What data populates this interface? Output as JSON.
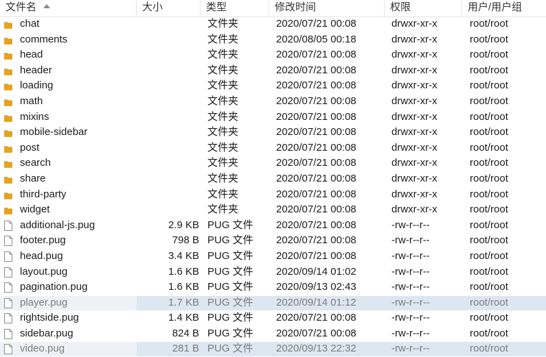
{
  "columns": {
    "name": "文件名",
    "size": "大小",
    "type": "类型",
    "modified": "修改时间",
    "perm": "权限",
    "owner": "用户/用户组"
  },
  "colors": {
    "folder": "#e8a317",
    "selection": "#dde7f1",
    "file_outline": "#8a8a8a"
  },
  "files": [
    {
      "name": "chat",
      "size": "",
      "type": "文件夹",
      "modified": "2020/07/21 00:08",
      "perm": "drwxr-xr-x",
      "owner": "root/root",
      "icon": "folder-icon",
      "selected": false
    },
    {
      "name": "comments",
      "size": "",
      "type": "文件夹",
      "modified": "2020/08/05 00:18",
      "perm": "drwxr-xr-x",
      "owner": "root/root",
      "icon": "folder-icon",
      "selected": false
    },
    {
      "name": "head",
      "size": "",
      "type": "文件夹",
      "modified": "2020/07/21 00:08",
      "perm": "drwxr-xr-x",
      "owner": "root/root",
      "icon": "folder-icon",
      "selected": false
    },
    {
      "name": "header",
      "size": "",
      "type": "文件夹",
      "modified": "2020/07/21 00:08",
      "perm": "drwxr-xr-x",
      "owner": "root/root",
      "icon": "folder-icon",
      "selected": false
    },
    {
      "name": "loading",
      "size": "",
      "type": "文件夹",
      "modified": "2020/07/21 00:08",
      "perm": "drwxr-xr-x",
      "owner": "root/root",
      "icon": "folder-icon",
      "selected": false
    },
    {
      "name": "math",
      "size": "",
      "type": "文件夹",
      "modified": "2020/07/21 00:08",
      "perm": "drwxr-xr-x",
      "owner": "root/root",
      "icon": "folder-icon",
      "selected": false
    },
    {
      "name": "mixins",
      "size": "",
      "type": "文件夹",
      "modified": "2020/07/21 00:08",
      "perm": "drwxr-xr-x",
      "owner": "root/root",
      "icon": "folder-icon",
      "selected": false
    },
    {
      "name": "mobile-sidebar",
      "size": "",
      "type": "文件夹",
      "modified": "2020/07/21 00:08",
      "perm": "drwxr-xr-x",
      "owner": "root/root",
      "icon": "folder-icon",
      "selected": false
    },
    {
      "name": "post",
      "size": "",
      "type": "文件夹",
      "modified": "2020/07/21 00:08",
      "perm": "drwxr-xr-x",
      "owner": "root/root",
      "icon": "folder-icon",
      "selected": false
    },
    {
      "name": "search",
      "size": "",
      "type": "文件夹",
      "modified": "2020/07/21 00:08",
      "perm": "drwxr-xr-x",
      "owner": "root/root",
      "icon": "folder-icon",
      "selected": false
    },
    {
      "name": "share",
      "size": "",
      "type": "文件夹",
      "modified": "2020/07/21 00:08",
      "perm": "drwxr-xr-x",
      "owner": "root/root",
      "icon": "folder-icon",
      "selected": false
    },
    {
      "name": "third-party",
      "size": "",
      "type": "文件夹",
      "modified": "2020/07/21 00:08",
      "perm": "drwxr-xr-x",
      "owner": "root/root",
      "icon": "folder-icon",
      "selected": false
    },
    {
      "name": "widget",
      "size": "",
      "type": "文件夹",
      "modified": "2020/07/21 00:08",
      "perm": "drwxr-xr-x",
      "owner": "root/root",
      "icon": "folder-icon",
      "selected": false
    },
    {
      "name": "additional-js.pug",
      "size": "2.9 KB",
      "type": "PUG 文件",
      "modified": "2020/07/21 00:08",
      "perm": "-rw-r--r--",
      "owner": "root/root",
      "icon": "file-icon",
      "selected": false
    },
    {
      "name": "footer.pug",
      "size": "798 B",
      "type": "PUG 文件",
      "modified": "2020/07/21 00:08",
      "perm": "-rw-r--r--",
      "owner": "root/root",
      "icon": "file-icon",
      "selected": false
    },
    {
      "name": "head.pug",
      "size": "3.4 KB",
      "type": "PUG 文件",
      "modified": "2020/07/21 00:08",
      "perm": "-rw-r--r--",
      "owner": "root/root",
      "icon": "file-icon",
      "selected": false
    },
    {
      "name": "layout.pug",
      "size": "1.6 KB",
      "type": "PUG 文件",
      "modified": "2020/09/14 01:02",
      "perm": "-rw-r--r--",
      "owner": "root/root",
      "icon": "file-icon",
      "selected": false
    },
    {
      "name": "pagination.pug",
      "size": "1.6 KB",
      "type": "PUG 文件",
      "modified": "2020/09/13 02:43",
      "perm": "-rw-r--r--",
      "owner": "root/root",
      "icon": "file-icon",
      "selected": false
    },
    {
      "name": "player.pug",
      "size": "1.7 KB",
      "type": "PUG 文件",
      "modified": "2020/09/14 01:12",
      "perm": "-rw-r--r--",
      "owner": "root/root",
      "icon": "file-icon",
      "selected": true
    },
    {
      "name": "rightside.pug",
      "size": "1.4 KB",
      "type": "PUG 文件",
      "modified": "2020/07/21 00:08",
      "perm": "-rw-r--r--",
      "owner": "root/root",
      "icon": "file-icon",
      "selected": false
    },
    {
      "name": "sidebar.pug",
      "size": "824 B",
      "type": "PUG 文件",
      "modified": "2020/07/21 00:08",
      "perm": "-rw-r--r--",
      "owner": "root/root",
      "icon": "file-icon",
      "selected": false
    },
    {
      "name": "video.pug",
      "size": "281 B",
      "type": "PUG 文件",
      "modified": "2020/09/13 22:32",
      "perm": "-rw-r--r--",
      "owner": "root/root",
      "icon": "file-icon",
      "selected": true
    }
  ]
}
